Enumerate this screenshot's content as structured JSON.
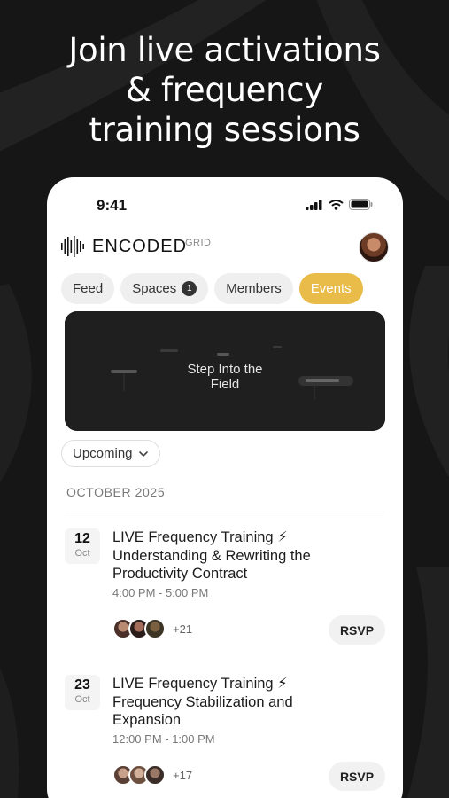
{
  "headline": [
    "Join live activations",
    "& frequency",
    "training sessions"
  ],
  "status_bar": {
    "time": "9:41"
  },
  "app": {
    "brand": "ENCODED",
    "brand_sub": "GRID"
  },
  "tabs": [
    {
      "label": "Feed",
      "badge": null,
      "active": false
    },
    {
      "label": "Spaces",
      "badge": "1",
      "active": false
    },
    {
      "label": "Members",
      "badge": null,
      "active": false
    },
    {
      "label": "Events",
      "badge": null,
      "active": true
    }
  ],
  "hero": {
    "line1": "Step Into the",
    "line2": "Field"
  },
  "filter": {
    "selected": "Upcoming"
  },
  "month_header": "OCTOBER 2025",
  "events": [
    {
      "day": "12",
      "month": "Oct",
      "title_line1": "LIVE Frequency Training ⚡",
      "title_line2": "Understanding & Rewriting the",
      "title_line3": "Productivity Contract",
      "time": "4:00 PM - 5:00 PM",
      "attendee_count": "+21",
      "rsvp": "RSVP"
    },
    {
      "day": "23",
      "month": "Oct",
      "title_line1": "LIVE Frequency Training ⚡",
      "title_line2": "Frequency Stabilization and",
      "title_line3": "Expansion",
      "time": "12:00 PM - 1:00 PM",
      "attendee_count": "+17",
      "rsvp": "RSVP"
    }
  ],
  "colors": {
    "accent": "#e9bb49",
    "background": "#161616"
  }
}
